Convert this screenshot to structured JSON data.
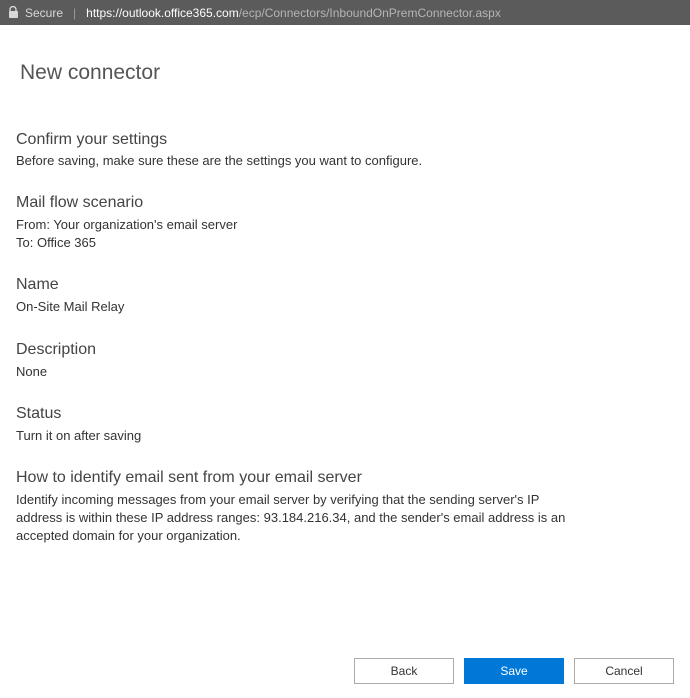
{
  "addressbar": {
    "secure_label": "Secure",
    "url_origin": "https://outlook.office365.com",
    "url_path": "/ecp/Connectors/InboundOnPremConnector.aspx"
  },
  "page_title": "New connector",
  "confirm": {
    "heading": "Confirm your settings",
    "sub": "Before saving, make sure these are the settings you want to configure."
  },
  "mailflow": {
    "label": "Mail flow scenario",
    "from": "From: Your organization's email server",
    "to": "To: Office 365"
  },
  "name": {
    "label": "Name",
    "value": "On-Site Mail Relay"
  },
  "description": {
    "label": "Description",
    "value": "None"
  },
  "status": {
    "label": "Status",
    "value": "Turn it on after saving"
  },
  "identify": {
    "label": "How to identify email sent from your email server",
    "value": "Identify incoming messages from your email server by verifying that the sending server's IP address is within these IP address ranges: 93.184.216.34, and the sender's email address is an accepted domain for your organization."
  },
  "buttons": {
    "back": "Back",
    "save": "Save",
    "cancel": "Cancel"
  }
}
